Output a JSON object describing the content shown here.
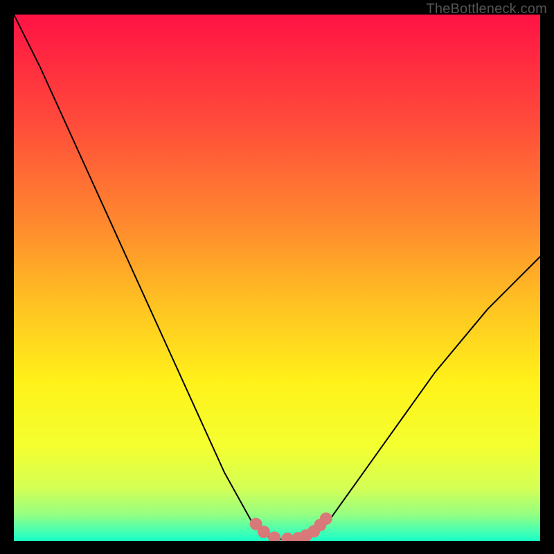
{
  "watermark": "TheBottleneck.com",
  "chart_data": {
    "type": "line",
    "title": "",
    "xlabel": "",
    "ylabel": "",
    "xlim": [
      0,
      100
    ],
    "ylim": [
      0,
      100
    ],
    "series": [
      {
        "name": "bottleneck-curve",
        "x": [
          0,
          5,
          10,
          15,
          20,
          25,
          30,
          35,
          40,
          45,
          47,
          49,
          51,
          53,
          55,
          57,
          60,
          65,
          70,
          75,
          80,
          85,
          90,
          95,
          100
        ],
        "values": [
          100,
          90,
          79,
          68,
          57,
          46,
          35,
          24,
          13,
          4,
          1.5,
          0.5,
          0.3,
          0.3,
          0.5,
          1.5,
          4,
          11,
          18,
          25,
          32,
          38,
          44,
          49,
          54
        ]
      },
      {
        "name": "marker-dots",
        "x": [
          46,
          47.5,
          49.5,
          52,
          54,
          55.5,
          57,
          58.2,
          59.3
        ],
        "values": [
          3.2,
          1.7,
          0.6,
          0.4,
          0.5,
          1.0,
          1.8,
          3.0,
          4.2
        ]
      }
    ],
    "gradient_stops": [
      {
        "offset": 0.0,
        "color": "#ff1244"
      },
      {
        "offset": 0.2,
        "color": "#ff4a3b"
      },
      {
        "offset": 0.4,
        "color": "#ff8a2e"
      },
      {
        "offset": 0.55,
        "color": "#ffc222"
      },
      {
        "offset": 0.7,
        "color": "#fff21a"
      },
      {
        "offset": 0.82,
        "color": "#f4ff30"
      },
      {
        "offset": 0.9,
        "color": "#d4ff55"
      },
      {
        "offset": 0.95,
        "color": "#95ff82"
      },
      {
        "offset": 0.98,
        "color": "#4affb0"
      },
      {
        "offset": 1.0,
        "color": "#18ffc8"
      }
    ],
    "marker_color": "#d97878",
    "line_color": "#000000"
  }
}
